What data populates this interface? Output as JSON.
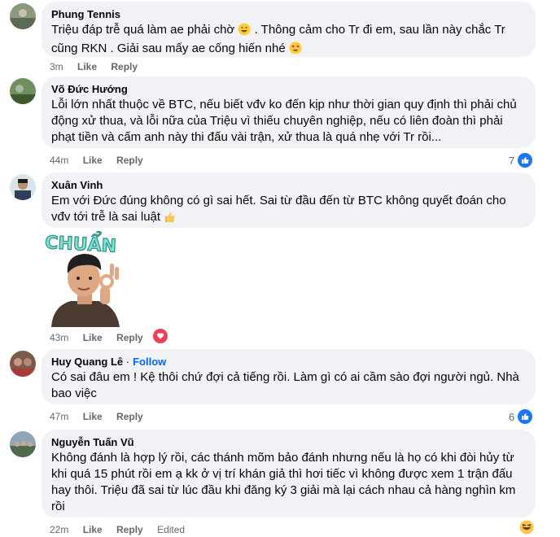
{
  "comments": [
    {
      "author": "Phung Tennis",
      "text": "Triệu đáp trễ quá làm ae phải chờ",
      "text2": ". Thông cảm cho Tr đi em, sau lần này chắc Tr cũng RKN . Giải sau mấy ae cống hiến nhé",
      "time": "3m",
      "like": "Like",
      "reply": "Reply"
    },
    {
      "author": "Võ Đức Hướng",
      "text": "Lỗi lớn nhất thuộc về BTC, nếu biết vđv ko đến kịp như thời gian quy định thì phải chủ động xử thua, và lỗi nữa của Triệu vì thiếu chuyên nghiệp, nếu có liên đoàn thì phải phạt tiền và cấm anh này thi đấu vài trận, xử thua là quá nhẹ với Tr rồi...",
      "time": "44m",
      "like": "Like",
      "reply": "Reply",
      "reaction_count": "7"
    },
    {
      "author": "Xuân Vinh",
      "text": "Em với Đức đúng không có gì sai hết. Sai từ đầu đến từ BTC không quyết đoán cho vđv tới trễ là sai luật",
      "sticker_text": "CHUẨN",
      "time": "43m",
      "like": "Like",
      "reply": "Reply"
    },
    {
      "author": "Huy Quang Lê",
      "follow": "Follow",
      "separator": "·",
      "text": "Có sai đâu em ! Kệ thôi chứ đợi cả tiếng rồi. Làm gì có ai cầm sào đợi người ngủ. Nhà bao việc",
      "time": "47m",
      "like": "Like",
      "reply": "Reply",
      "reaction_count": "6"
    },
    {
      "author": "Nguyễn Tuấn Vũ",
      "text": "Không đánh là hợp lý rồi, các thánh mõm bảo đánh nhưng nếu là họ có khi đòi hủy từ khi quá 15 phút rồi em ạ kk ở vị trí khán giả thì hơi tiếc vì không được xem 1 trận đấu hay thôi. Triệu đã sai từ lúc đầu khi đăng ký 3 giải mà lại cách nhau cả hàng nghìn km rồi",
      "time": "22m",
      "like": "Like",
      "reply": "Reply",
      "edited": "Edited"
    }
  ]
}
